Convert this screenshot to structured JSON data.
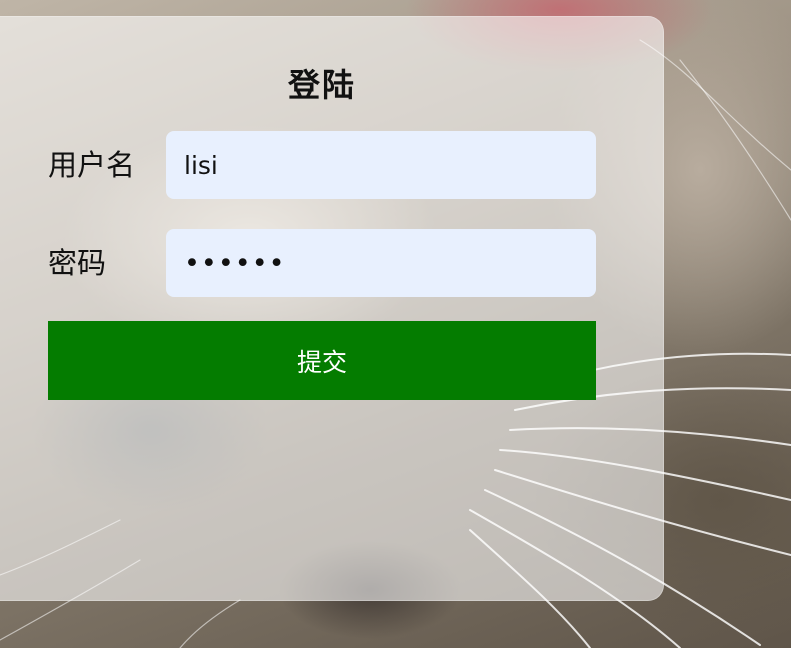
{
  "page": {
    "title": "登陆"
  },
  "form": {
    "username": {
      "label": "用户名",
      "value": "lisi"
    },
    "password": {
      "label": "密码",
      "mask": "••••••"
    },
    "submit_label": "提交"
  },
  "colors": {
    "input_background": "#e8f0fe",
    "submit_background": "#047c00",
    "card_overlay": "rgba(255,255,255,0.58)"
  }
}
